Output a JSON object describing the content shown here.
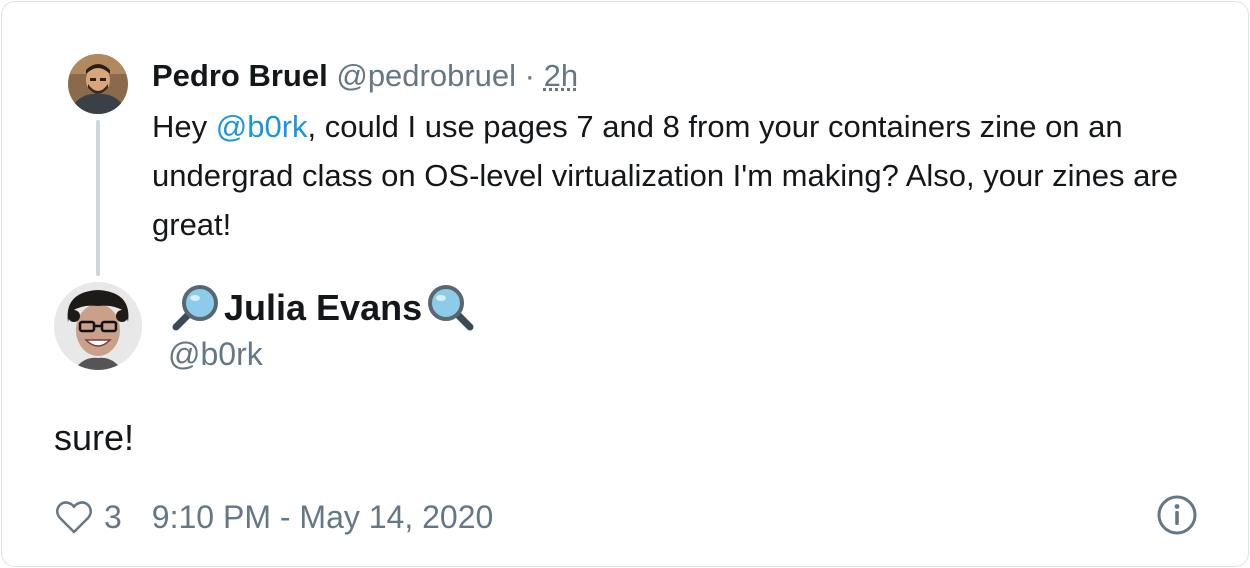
{
  "parent_tweet": {
    "name": "Pedro Bruel",
    "handle": "@pedrobruel",
    "separator": "·",
    "time_ago": "2h",
    "text_before": "Hey ",
    "mention": "@b0rk",
    "text_after": ", could I use pages 7 and 8 from your containers zine on an undergrad class on OS-level virtualization I'm making? Also, your zines are great!"
  },
  "main_tweet": {
    "name": "Julia Evans",
    "name_prefix_emoji": "left-pointing-magnifying-glass",
    "name_suffix_emoji": "right-pointing-magnifying-glass",
    "handle": "@b0rk",
    "text": "sure!",
    "like_count": "3",
    "datetime": "9:10 PM - May 14, 2020"
  },
  "colors": {
    "text": "#14171a",
    "secondary": "#657786",
    "link": "#1b95e0",
    "thread_line": "#ccd6dd",
    "border": "#dfe3e7"
  }
}
